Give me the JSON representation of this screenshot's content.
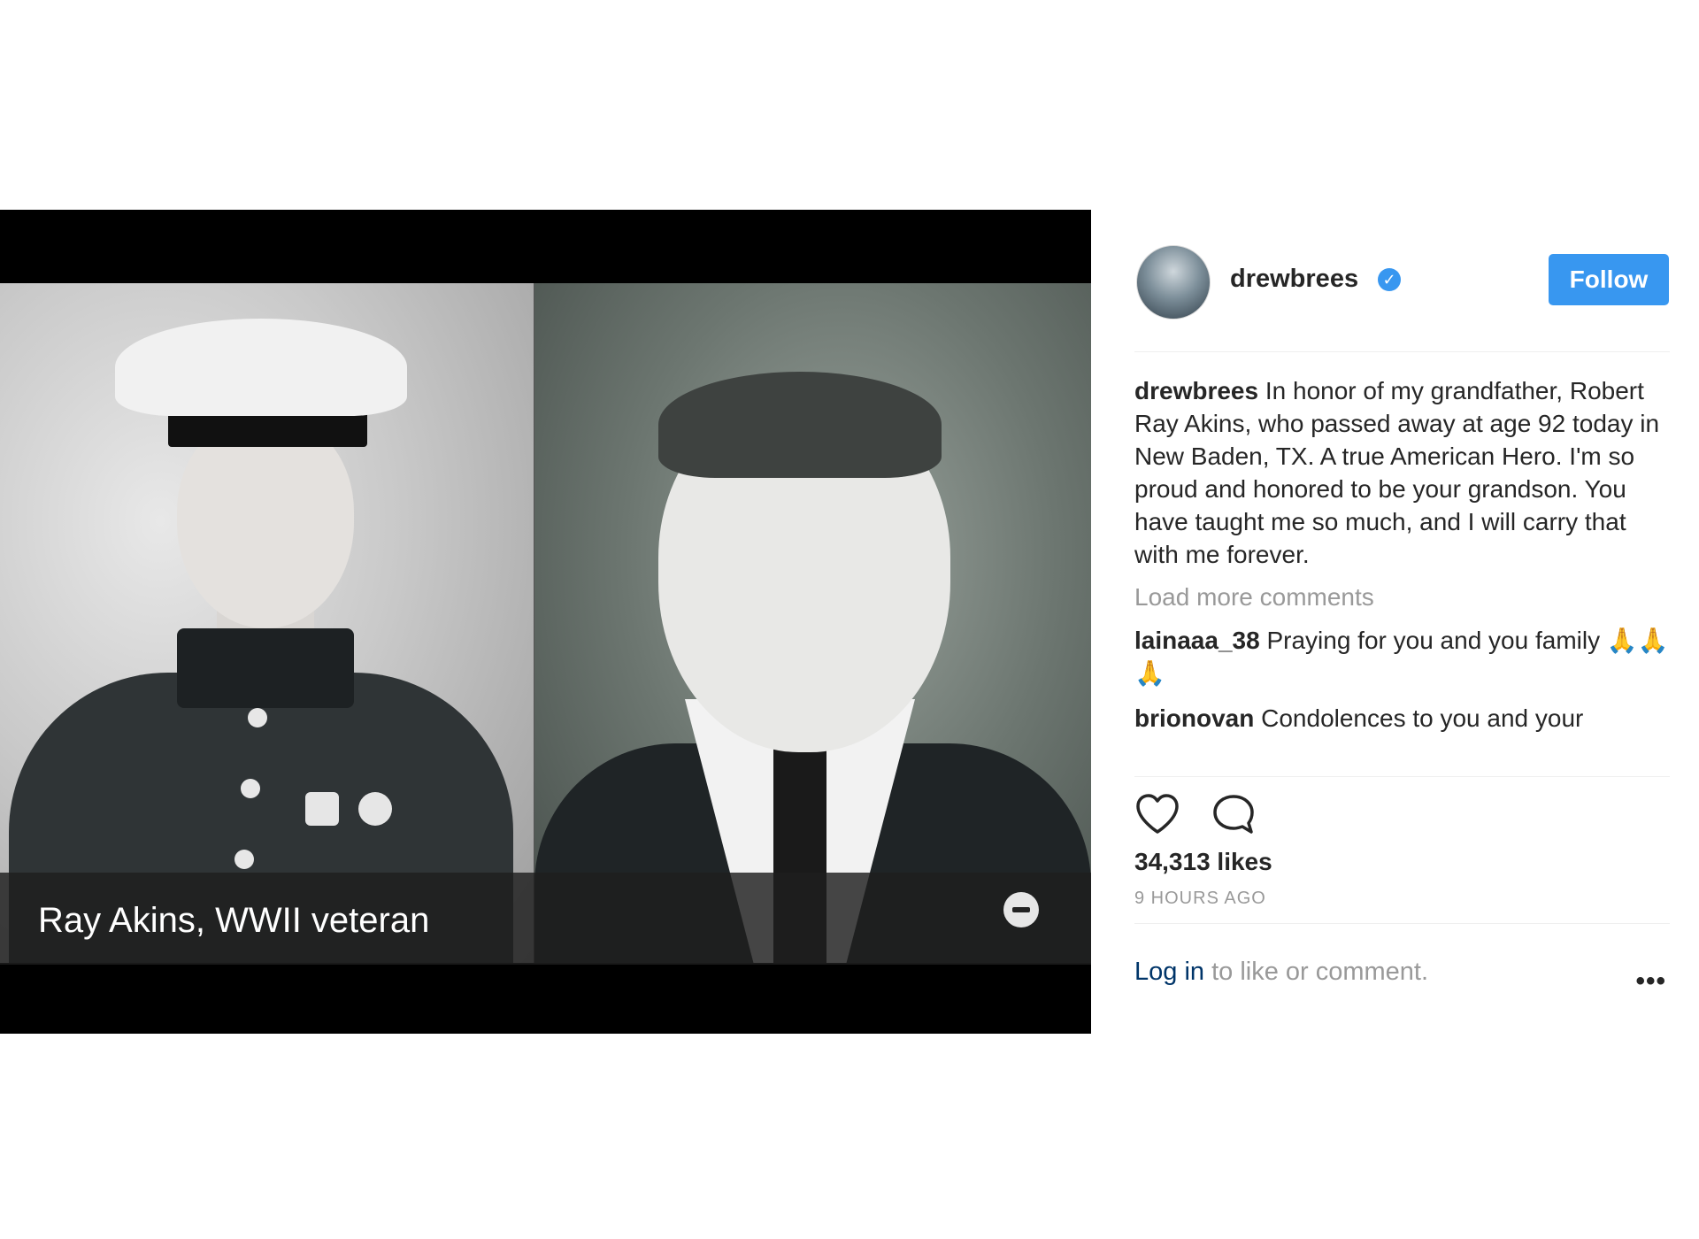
{
  "media": {
    "caption": "Ray Akins, WWII veteran",
    "left_photo_icon": "portrait-young-marine",
    "right_photo_icon": "portrait-older-man"
  },
  "post": {
    "username": "drewbrees",
    "verified_icon": "verified-badge-icon",
    "follow_label": "Follow",
    "accent_color": "#3897f0"
  },
  "comments": {
    "caption_author": "drewbrees",
    "caption_text": "In honor of my grandfather, Robert Ray Akins, who passed away at age 92 today in New Baden, TX. A true American Hero. I'm so proud and honored to be your grandson. You have taught me so much, and I will carry that with me forever.",
    "load_more": "Load more comments",
    "items": [
      {
        "author": "lainaaa_38",
        "text": "Praying for you and you family 🙏🙏🙏"
      },
      {
        "author": "brionovan",
        "text": "Condolences to you and your"
      }
    ]
  },
  "actions": {
    "like_icon": "heart-icon",
    "comment_icon": "comment-bubble-icon",
    "likes": "34,313 likes",
    "timestamp": "9 HOURS AGO"
  },
  "footer": {
    "login_label": "Log in",
    "prompt": " to like or comment.",
    "more_label": "•••"
  }
}
